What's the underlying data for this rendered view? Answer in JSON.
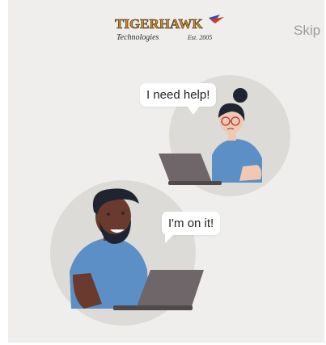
{
  "header": {
    "logo_main": "TIGERHAWK",
    "logo_sub": "Technologies",
    "logo_est": "Est. 2005",
    "skip_label": "Skip"
  },
  "illustration": {
    "customer_bubble": "I need help!",
    "agent_bubble": "I'm on it!"
  },
  "colors": {
    "background": "#efeeec",
    "circle": "#dcdbd7",
    "shirt": "#5b8fc6",
    "laptop": "#6e6668",
    "skin_dark": "#6b3a2e",
    "skin_light": "#f2c7b4",
    "hair": "#1f2430"
  }
}
